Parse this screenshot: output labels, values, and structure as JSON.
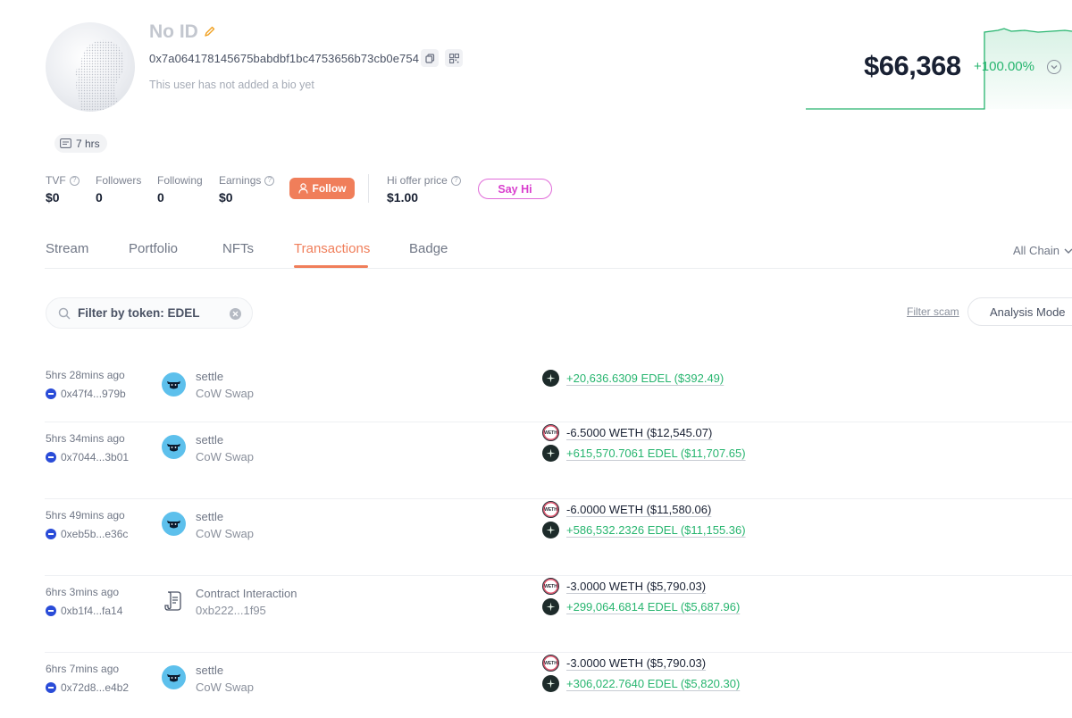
{
  "profile": {
    "name": "No ID",
    "address": "0x7a064178145675babdbf1bc4753656b73cb0e754",
    "bio": "This user has not added a bio yet",
    "age": "7 hrs"
  },
  "stats": [
    {
      "label": "TVF",
      "value": "$0"
    },
    {
      "label": "Followers",
      "value": "0"
    },
    {
      "label": "Following",
      "value": "0"
    },
    {
      "label": "Earnings",
      "value": "$0"
    }
  ],
  "follow_label": "Follow",
  "hi_offer": {
    "label": "Hi offer price",
    "value": "$1.00"
  },
  "sayhi_label": "Say Hi",
  "networth": {
    "value": "$66,368",
    "change": "+100.00%"
  },
  "tabs": [
    "Stream",
    "Portfolio",
    "NFTs",
    "Transactions",
    "Badge"
  ],
  "active_tab": "Transactions",
  "chain_filter": "All Chain",
  "search": {
    "value": "",
    "placeholder": "Filter by token: EDEL"
  },
  "filter_scam": "Filter scam",
  "analysis_mode": "Analysis Mode",
  "colors": {
    "accent": "#f07e5a",
    "positive": "#27b56f",
    "sayhi": "#d93fce",
    "chain": "#2a4cd8"
  },
  "transactions": [
    {
      "time": "5hrs 28mins ago",
      "hash": "0x47f4...979b",
      "method": "settle",
      "project": "CoW Swap",
      "project_icon": "cow-icon",
      "tokens": [
        {
          "icon": "edel-token-icon",
          "amount": "+20,636.6309 EDEL ($392.49)",
          "dir": "pos"
        }
      ]
    },
    {
      "time": "5hrs 34mins ago",
      "hash": "0x7044...3b01",
      "method": "settle",
      "project": "CoW Swap",
      "project_icon": "cow-icon",
      "tokens": [
        {
          "icon": "weth-token-icon",
          "amount": "-6.5000 WETH ($12,545.07)",
          "dir": "neg"
        },
        {
          "icon": "edel-token-icon",
          "amount": "+615,570.7061 EDEL ($11,707.65)",
          "dir": "pos"
        }
      ]
    },
    {
      "time": "5hrs 49mins ago",
      "hash": "0xeb5b...e36c",
      "method": "settle",
      "project": "CoW Swap",
      "project_icon": "cow-icon",
      "tokens": [
        {
          "icon": "weth-token-icon",
          "amount": "-6.0000 WETH ($11,580.06)",
          "dir": "neg"
        },
        {
          "icon": "edel-token-icon",
          "amount": "+586,532.2326 EDEL ($11,155.36)",
          "dir": "pos"
        }
      ]
    },
    {
      "time": "6hrs 3mins ago",
      "hash": "0xb1f4...fa14",
      "method": "Contract Interaction",
      "project": "0xb222...1f95",
      "project_icon": "contract-icon",
      "tokens": [
        {
          "icon": "weth-token-icon",
          "amount": "-3.0000 WETH ($5,790.03)",
          "dir": "neg"
        },
        {
          "icon": "edel-token-icon",
          "amount": "+299,064.6814 EDEL ($5,687.96)",
          "dir": "pos"
        }
      ]
    },
    {
      "time": "6hrs 7mins ago",
      "hash": "0x72d8...e4b2",
      "method": "settle",
      "project": "CoW Swap",
      "project_icon": "cow-icon",
      "tokens": [
        {
          "icon": "weth-token-icon",
          "amount": "-3.0000 WETH ($5,790.03)",
          "dir": "neg"
        },
        {
          "icon": "edel-token-icon",
          "amount": "+306,022.7640 EDEL ($5,820.30)",
          "dir": "pos"
        }
      ]
    }
  ]
}
